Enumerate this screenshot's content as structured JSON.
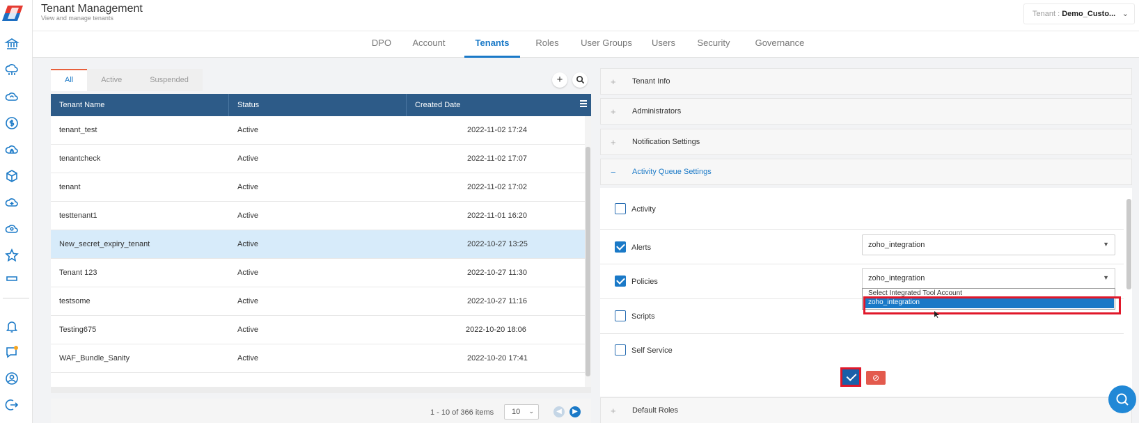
{
  "header": {
    "title": "Tenant Management",
    "subtitle": "View and manage tenants",
    "tenant_label": "Tenant : ",
    "tenant_value": "Demo_Custo..."
  },
  "tabs": [
    {
      "label": "DPO"
    },
    {
      "label": "Account"
    },
    {
      "label": "Tenants",
      "active": true
    },
    {
      "label": "Roles"
    },
    {
      "label": "User Groups"
    },
    {
      "label": "Users"
    },
    {
      "label": "Security"
    },
    {
      "label": "Governance"
    }
  ],
  "nav_icons": [
    "bank-icon",
    "cloud-network-icon",
    "cloud-sync-icon",
    "dollar-icon",
    "cloud-lock-icon",
    "cube-icon",
    "cloud-plus-icon",
    "cloud-user-icon",
    "star-icon",
    "menu-stub-icon",
    "bell-icon",
    "chat-icon",
    "user-circle-icon",
    "logout-icon"
  ],
  "filters": [
    "All",
    "Active",
    "Suspended"
  ],
  "table": {
    "columns": [
      "Tenant Name",
      "Status",
      "Created Date"
    ],
    "rows": [
      {
        "name": "tenant_test",
        "status": "Active",
        "created": "2022-11-02 17:24"
      },
      {
        "name": "tenantcheck",
        "status": "Active",
        "created": "2022-11-02 17:07"
      },
      {
        "name": "tenant",
        "status": "Active",
        "created": "2022-11-02 17:02"
      },
      {
        "name": "testtenant1",
        "status": "Active",
        "created": "2022-11-01 16:20"
      },
      {
        "name": "New_secret_expiry_tenant",
        "status": "Active",
        "created": "2022-10-27 13:25",
        "selected": true
      },
      {
        "name": "Tenant 123",
        "status": "Active",
        "created": "2022-10-27 11:30"
      },
      {
        "name": "testsome",
        "status": "Active",
        "created": "2022-10-27 11:16"
      },
      {
        "name": "Testing675",
        "status": "Active",
        "created": "2022-10-20 18:06"
      },
      {
        "name": "WAF_Bundle_Sanity",
        "status": "Active",
        "created": "2022-10-20 17:41"
      }
    ]
  },
  "pager": {
    "summary": "1 - 10 of 366 items",
    "page_size": "10"
  },
  "accordion": {
    "sections": [
      "Tenant Info",
      "Administrators",
      "Notification Settings",
      "Activity Queue Settings",
      "Default Roles"
    ],
    "open_section": "Activity Queue Settings"
  },
  "activity_queue": {
    "rows": [
      {
        "label": "Activity",
        "checked": false,
        "select": null
      },
      {
        "label": "Alerts",
        "checked": true,
        "select": "zoho_integration"
      },
      {
        "label": "Policies",
        "checked": true,
        "select": "zoho_integration"
      },
      {
        "label": "Scripts",
        "checked": false,
        "select": null
      },
      {
        "label": "Self Service",
        "checked": false,
        "select": null
      }
    ],
    "dropdown_options": [
      "Select Integrated Tool Account",
      "zoho_integration"
    ],
    "dropdown_highlighted": "zoho_integration",
    "cancel_glyph": "⊘"
  },
  "colors": {
    "accent": "#1a79c7",
    "table_header": "#2d5b88",
    "highlight_box": "#e0182a",
    "cancel": "#e35a4d"
  }
}
